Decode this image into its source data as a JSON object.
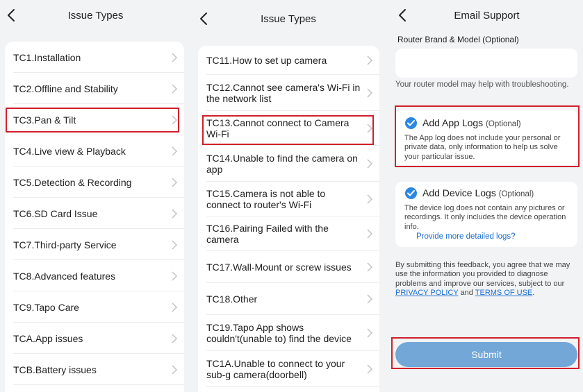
{
  "panel1": {
    "title": "Issue Types",
    "items": [
      {
        "label": "TC1.Installation"
      },
      {
        "label": "TC2.Offline and Stability"
      },
      {
        "label": "TC3.Pan & Tilt"
      },
      {
        "label": "TC4.Live view & Playback"
      },
      {
        "label": "TC5.Detection & Recording"
      },
      {
        "label": "TC6.SD Card Issue"
      },
      {
        "label": "TC7.Third-party Service"
      },
      {
        "label": "TC8.Advanced features"
      },
      {
        "label": "TC9.Tapo Care"
      },
      {
        "label": "TCA.App issues"
      },
      {
        "label": "TCB.Battery issues"
      }
    ]
  },
  "panel2": {
    "title": "Issue Types",
    "items": [
      {
        "label": "TC11.How to set up camera"
      },
      {
        "label": "TC12.Cannot see camera's Wi-Fi in the network list"
      },
      {
        "label": "TC13.Cannot connect to Camera Wi-Fi"
      },
      {
        "label": "TC14.Unable to find the camera on app"
      },
      {
        "label": "TC15.Camera is not able to connect to router's Wi-Fi"
      },
      {
        "label": "TC16.Pairing Failed with the camera"
      },
      {
        "label": "TC17.Wall-Mount or screw issues"
      },
      {
        "label": "TC18.Other"
      },
      {
        "label": "TC19.Tapo App shows couldn't(unable to) find the device"
      },
      {
        "label": "TC1A.Unable to connect to your sub-g camera(doorbell)"
      }
    ]
  },
  "panel3": {
    "title": "Email Support",
    "router_label": "Router Brand & Model (Optional)",
    "router_value": "",
    "router_hint": "Your router model may help with troubleshooting.",
    "app_logs": {
      "title": "Add App Logs",
      "optional": "(Optional)",
      "desc": "The App log does not include your personal or private data, only information to help us solve your particular issue."
    },
    "device_logs": {
      "title": "Add Device Logs",
      "optional": "(Optional)",
      "desc": "The device log does not contain any pictures or recordings. It only includes the device operation info.",
      "link": "Provide more detailed logs?"
    },
    "terms": {
      "text": "By submitting this feedback, you agree that we may use the information you provided to diagnose problems and improve our services, subject to our",
      "privacy": "PRIVACY POLICY",
      "and": "and",
      "tos": "TERMS OF USE",
      "end": "."
    },
    "submit": "Submit"
  },
  "colors": {
    "accent": "#2a88e0",
    "link": "#1c6fd1",
    "highlight": "#d0202a",
    "submit_bg": "#72a7d8",
    "background": "#f2f3f5"
  },
  "icons": {
    "back": "chevron-left-icon",
    "row": "chevron-right-icon",
    "checked": "check-circle-icon"
  }
}
